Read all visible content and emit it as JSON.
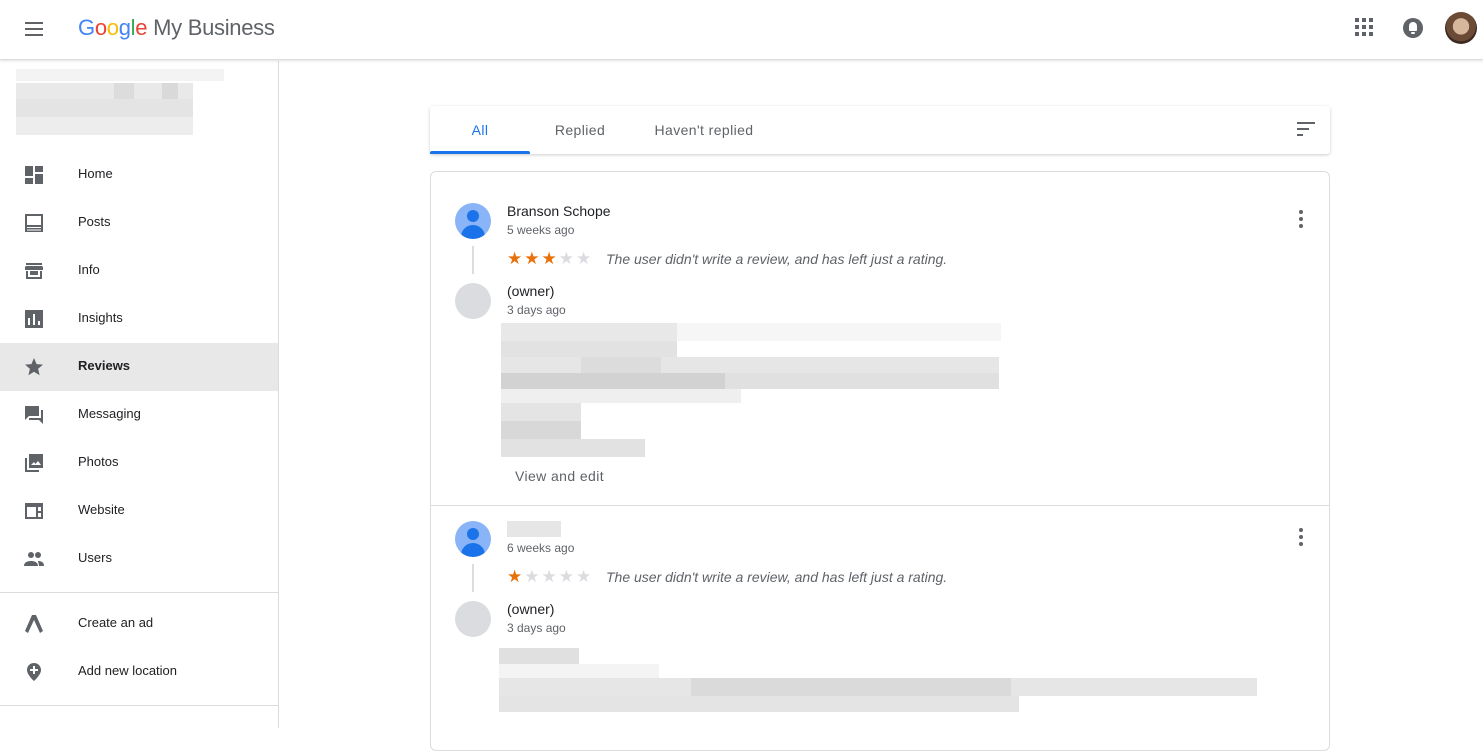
{
  "header": {
    "logo_google": [
      "G",
      "o",
      "o",
      "g",
      "l",
      "e"
    ],
    "product_name": "My Business",
    "icons": [
      "menu-icon",
      "apps-icon",
      "notifications-icon",
      "account-avatar"
    ]
  },
  "sidebar": {
    "items": [
      {
        "label": "Home",
        "icon": "dashboard-icon"
      },
      {
        "label": "Posts",
        "icon": "posts-icon"
      },
      {
        "label": "Info",
        "icon": "store-icon"
      },
      {
        "label": "Insights",
        "icon": "insights-icon"
      },
      {
        "label": "Reviews",
        "icon": "star-icon",
        "active": true
      },
      {
        "label": "Messaging",
        "icon": "messaging-icon"
      },
      {
        "label": "Photos",
        "icon": "photos-icon"
      },
      {
        "label": "Website",
        "icon": "website-icon"
      },
      {
        "label": "Users",
        "icon": "users-icon"
      }
    ],
    "secondary_items": [
      {
        "label": "Create an ad",
        "icon": "google-ads-icon"
      },
      {
        "label": "Add new location",
        "icon": "add-location-icon"
      }
    ]
  },
  "tabs": {
    "items": [
      "All",
      "Replied",
      "Haven't replied"
    ],
    "active": "All"
  },
  "reviews": [
    {
      "reviewer": "Branson Schope",
      "time": "5 weeks ago",
      "rating": 3,
      "max_rating": 5,
      "note": "The user didn't write a review, and has left just a rating.",
      "reply": {
        "author": "(owner)",
        "time": "3 days ago",
        "action": "View and edit"
      }
    },
    {
      "reviewer": "",
      "time": "6 weeks ago",
      "rating": 1,
      "max_rating": 5,
      "note": "The user didn't write a review, and has left just a rating.",
      "reply": {
        "author": "(owner)",
        "time": "3 days ago"
      }
    }
  ],
  "colors": {
    "accent": "#1a73e8",
    "star": "#e8710a",
    "star_empty": "#dadce0",
    "active_nav_bg": "#e8e8e8"
  }
}
